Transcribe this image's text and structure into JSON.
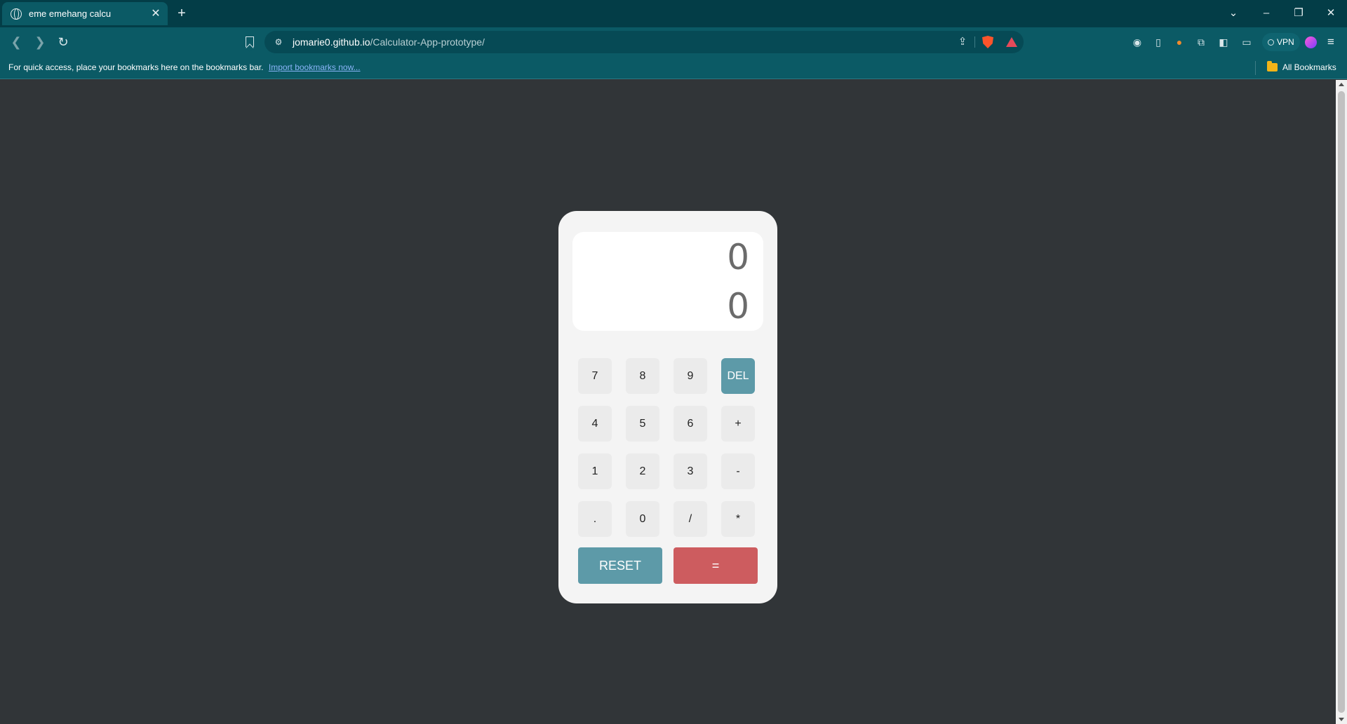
{
  "browser": {
    "tab": {
      "title": "eme emehang calcu",
      "close": "✕"
    },
    "new_tab": "+",
    "window_controls": {
      "tab_search": "⌄",
      "minimize": "–",
      "restore": "❐",
      "close": "✕"
    },
    "nav": {
      "back": "❮",
      "forward": "❯",
      "reload": "↻"
    },
    "address": {
      "domain": "jomarie0.github.io",
      "path": "/Calculator-App-prototype/"
    },
    "vpn_label": "VPN",
    "menu": "≡",
    "bookmarks_bar": {
      "message": "For quick access, place your bookmarks here on the bookmarks bar.",
      "import_link": "Import bookmarks now...",
      "all_bookmarks": "All Bookmarks"
    }
  },
  "calculator": {
    "display": {
      "previous": "0",
      "current": "0"
    },
    "keys": {
      "k7": "7",
      "k8": "8",
      "k9": "9",
      "del": "DEL",
      "k4": "4",
      "k5": "5",
      "k6": "6",
      "plus": "+",
      "k1": "1",
      "k2": "2",
      "k3": "3",
      "minus": "-",
      "dot": ".",
      "k0": "0",
      "divide": "/",
      "multiply": "*"
    },
    "reset_label": "RESET",
    "equals_label": "=",
    "colors": {
      "accent": "#5d9aa8",
      "equals": "#cd5c5f",
      "page_bg": "#313538"
    }
  }
}
